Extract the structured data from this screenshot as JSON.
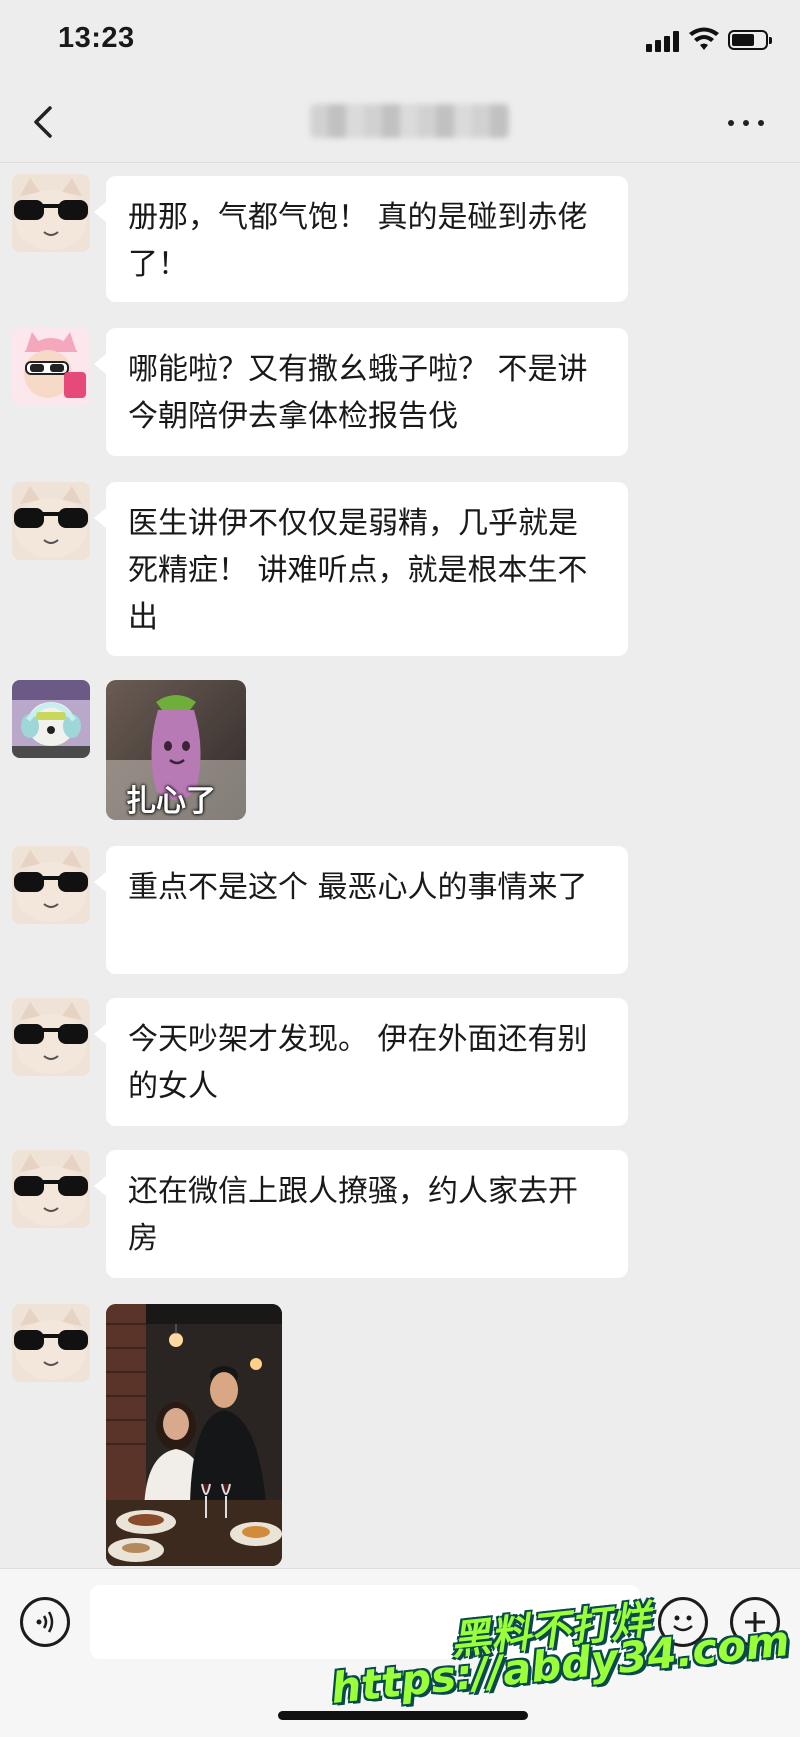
{
  "status": {
    "time": "13:23"
  },
  "nav": {
    "title": ""
  },
  "messages": [
    {
      "type": "text",
      "avatar": "sunglasses-cat-icon",
      "text": "册那，气都气饱！ 真的是碰到赤佬了！"
    },
    {
      "type": "text",
      "avatar": "pink-hat-girl-avatar",
      "text": "哪能啦？又有撒幺蛾子啦？ 不是讲今朝陪伊去拿体检报告伐"
    },
    {
      "type": "text",
      "avatar": "sunglasses-cat-icon",
      "text": "医生讲伊不仅仅是弱精，几乎就是死精症！ 讲难听点，就是根本生不出"
    },
    {
      "type": "sticker",
      "avatar": "dog-headphones-avatar",
      "caption": "扎心了"
    },
    {
      "type": "text",
      "avatar": "sunglasses-cat-icon",
      "text": "重点不是这个 最恶心人的事情来了"
    },
    {
      "type": "text",
      "avatar": "sunglasses-cat-icon",
      "text": "今天吵架才发现。 伊在外面还有别的女人"
    },
    {
      "type": "text",
      "avatar": "sunglasses-cat-icon",
      "text": "还在微信上跟人撩骚，约人家去开房"
    },
    {
      "type": "photo",
      "avatar": "sunglasses-cat-icon"
    }
  ],
  "input": {
    "value": "",
    "placeholder": ""
  },
  "watermark": {
    "line1": "黑料不打烊",
    "line2": "https://abdy34.com"
  },
  "colors": {
    "background": "#ededed",
    "bubble": "#ffffff",
    "watermark": "#9bff3a"
  }
}
